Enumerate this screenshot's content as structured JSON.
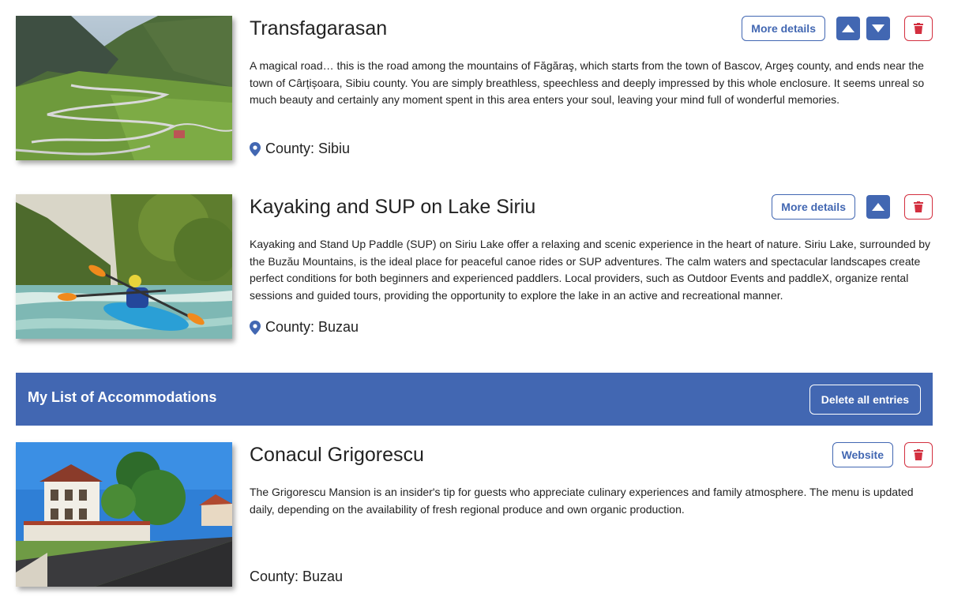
{
  "attractions": [
    {
      "title": "Transfagarasan",
      "description": "A magical road… this is the road among the mountains of Făgăraş, which starts from the town of Bascov, Argeş county, and ends near the town of Cârțișoara, Sibiu county. You are simply breathless, speechless and deeply impressed by this whole enclosure. It seems unreal so much beauty and certainly any moment spent in this area enters your soul, leaving your mind full of wonderful memories.",
      "county": "County: Sibiu",
      "more_details": "More details"
    },
    {
      "title": "Kayaking and SUP on Lake Siriu",
      "description": "Kayaking and Stand Up Paddle (SUP) on Siriu Lake offer a relaxing and scenic experience in the heart of nature. Siriu Lake, surrounded by the Buzău Mountains, is the ideal place for peaceful canoe rides or SUP adventures. The calm waters and spectacular landscapes create perfect conditions for both beginners and experienced paddlers. Local providers, such as Outdoor Events and paddleX, organize rental sessions and guided tours, providing the opportunity to explore the lake in an active and recreational manner.",
      "county": "County: Buzau",
      "more_details": "More details"
    }
  ],
  "accommodations_section": {
    "title": "My List of Accommodations",
    "delete_all": "Delete all entries"
  },
  "accommodations": [
    {
      "title": "Conacul Grigorescu",
      "description": "The Grigorescu Mansion is an insider's tip for guests who appreciate culinary experiences and family atmosphere. The menu is updated daily, depending on the availability of fresh regional produce and own organic production.",
      "county": "County: Buzau",
      "website": "Website"
    }
  ],
  "icons": {
    "location": "map-pin-icon",
    "up": "arrow-up-icon",
    "down": "arrow-down-icon",
    "delete": "trash-icon"
  },
  "colors": {
    "primary": "#4267b2",
    "danger": "#d32f3f",
    "text": "#222222"
  }
}
